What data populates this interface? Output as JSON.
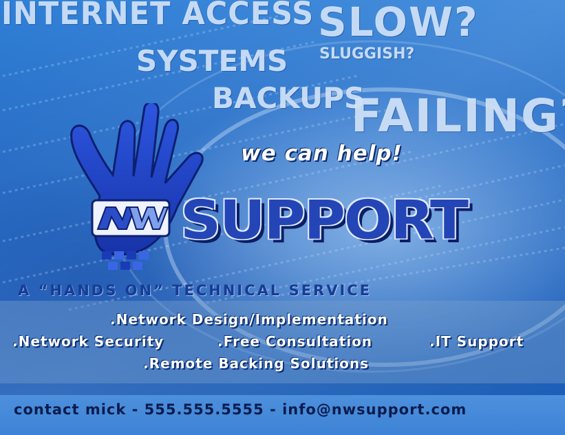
{
  "headlines": {
    "line1": "INTERNET ACCESS",
    "line2": "SLOW?",
    "line3": "SYSTEMS",
    "line4": "SLUGGISH?",
    "line5": "BACKUPS",
    "line6": "FAILING?"
  },
  "tagline": "we can help!",
  "brand": {
    "logo_letters": "NW",
    "word": "SUPPORT",
    "subtitle": "A “HANDS ON” TECHNICAL SERVICE"
  },
  "services": [
    ".Network Design/Implementation",
    ".Network Security",
    ".Free Consultation",
    ".IT Support",
    ".Remote Backing Solutions"
  ],
  "contact": "contact mick - 555.555.5555 - info@nwsupport.com",
  "colors": {
    "background": "#1d63c0",
    "hand": "#1f3fc4",
    "brand_text": "#2445b5",
    "headline_text": "#deeeff",
    "contact_bar": "#4d90dc"
  },
  "icons": {
    "hand": "open-hand-icon",
    "logo": "nw-logo"
  }
}
